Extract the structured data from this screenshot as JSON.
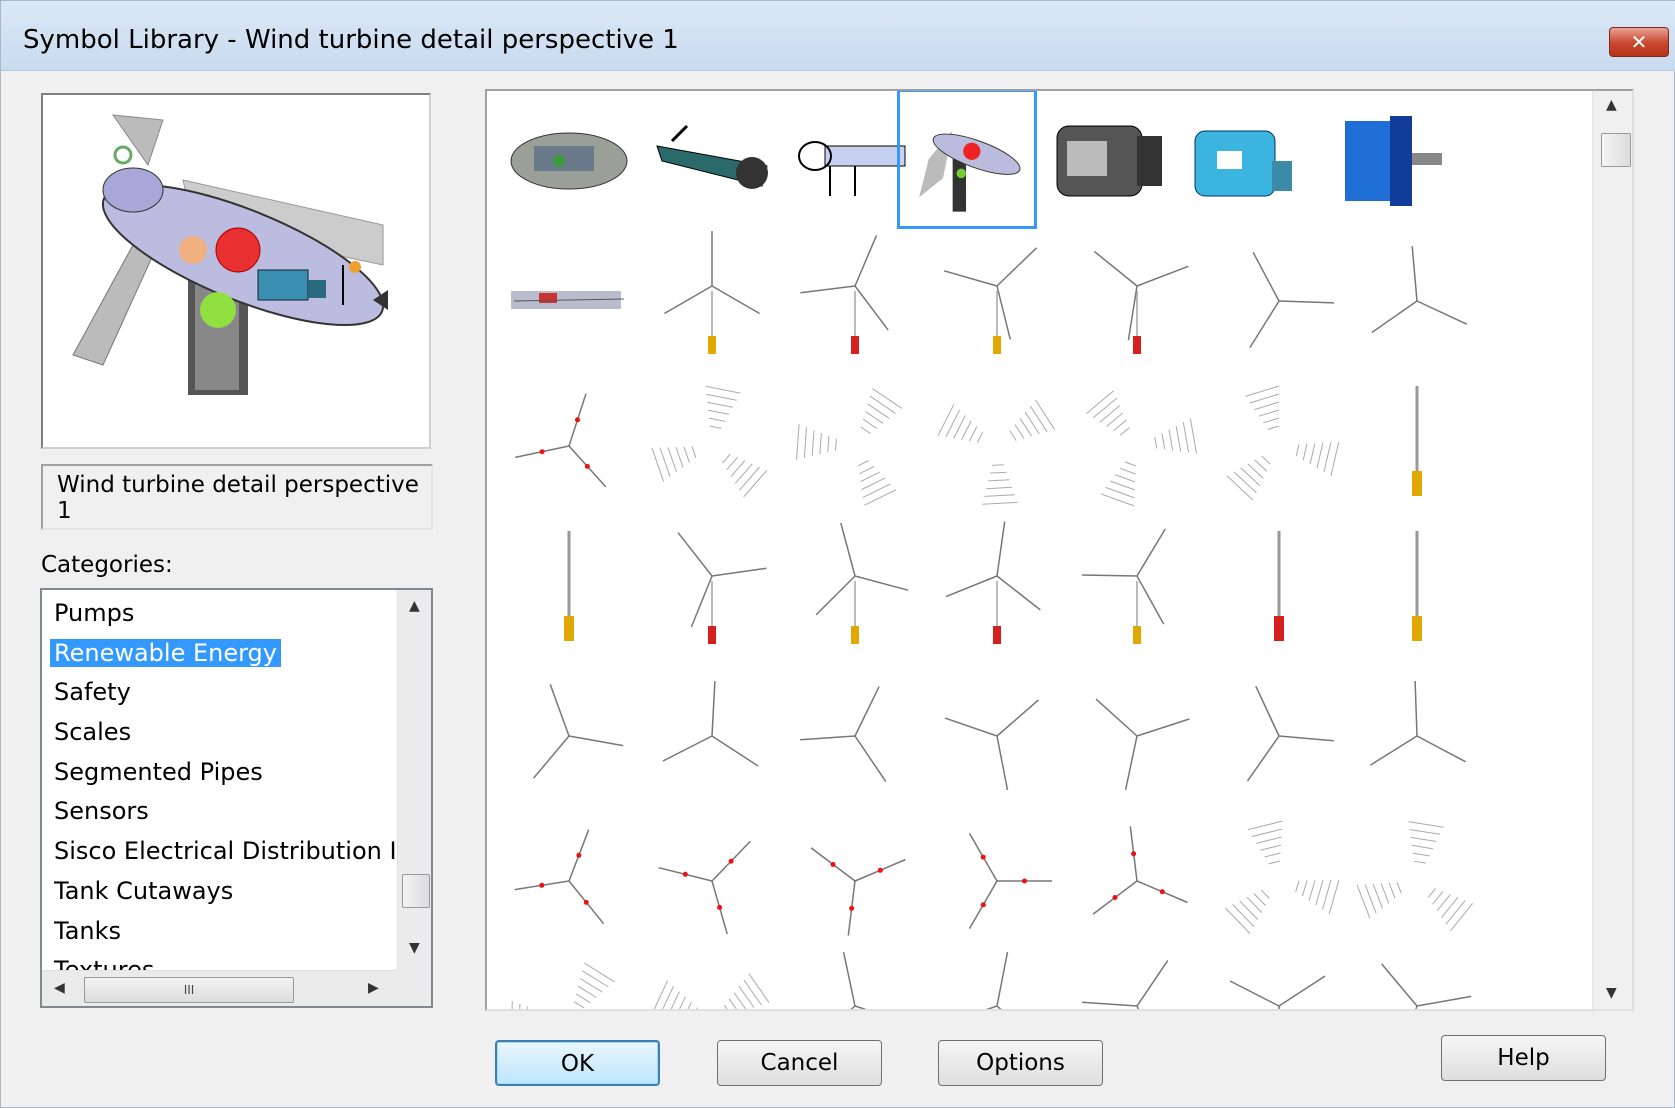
{
  "window": {
    "title": "Symbol Library - Wind turbine detail perspective 1",
    "close_label": "✕"
  },
  "preview": {
    "description": "Wind turbine detail perspective 1"
  },
  "categories": {
    "label": "Categories:",
    "items": [
      "Pumps",
      "Renewable Energy",
      "Safety",
      "Scales",
      "Segmented Pipes",
      "Sensors",
      "Sisco Electrical Distribution I",
      "Tank Cutaways",
      "Tanks",
      "Textures"
    ],
    "selected": "Renewable Energy",
    "hscroll_grip": "III"
  },
  "gallery": {
    "selected_index": 3
  },
  "buttons": {
    "ok": "OK",
    "cancel": "Cancel",
    "options": "Options",
    "help": "Help"
  }
}
